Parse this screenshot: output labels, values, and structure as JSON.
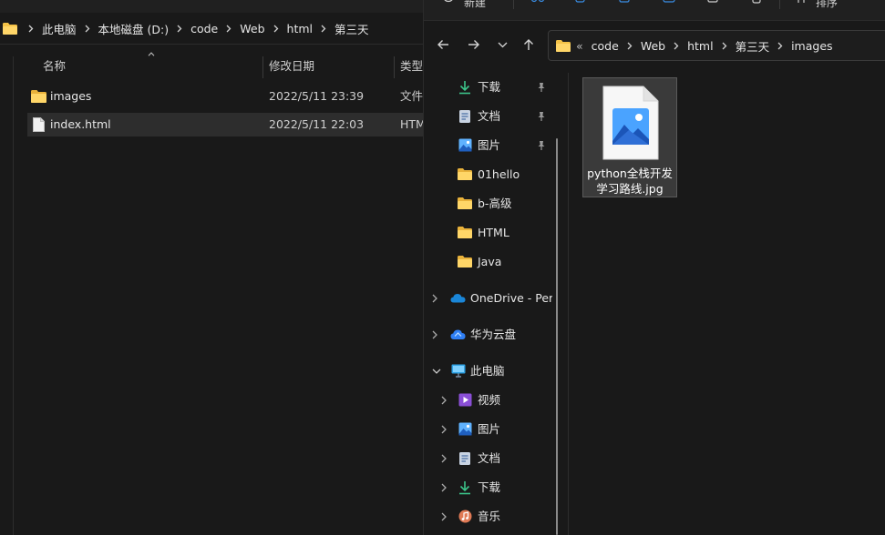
{
  "left_window": {
    "breadcrumb": [
      "此电脑",
      "本地磁盘 (D:)",
      "code",
      "Web",
      "html",
      "第三天"
    ],
    "columns": {
      "name": "名称",
      "modified": "修改日期",
      "type": "类型"
    },
    "files": [
      {
        "name": "images",
        "modified": "2022/5/11 23:39",
        "type": "文件",
        "icon": "folder-icon",
        "selected": false
      },
      {
        "name": "index.html",
        "modified": "2022/5/11 22:03",
        "type": "HTM",
        "icon": "file-icon",
        "selected": true
      }
    ]
  },
  "right_window": {
    "toolbar_partial": [
      "新建",
      "排序"
    ],
    "breadcrumb": [
      "code",
      "Web",
      "html",
      "第三天",
      "images"
    ],
    "breadcrumb_overflow": "«",
    "quick_access": [
      {
        "label": "下载",
        "icon": "download-icon",
        "pinned": true
      },
      {
        "label": "文档",
        "icon": "document-icon",
        "pinned": true
      },
      {
        "label": "图片",
        "icon": "pictures-icon",
        "pinned": true
      },
      {
        "label": "01hello",
        "icon": "folder-icon",
        "pinned": false
      },
      {
        "label": "b-高级",
        "icon": "folder-icon",
        "pinned": false
      },
      {
        "label": "HTML",
        "icon": "folder-icon",
        "pinned": false
      },
      {
        "label": "Java",
        "icon": "folder-icon",
        "pinned": false
      }
    ],
    "cloud": [
      {
        "label": "OneDrive - Pers",
        "icon": "onedrive-icon"
      },
      {
        "label": "华为云盘",
        "icon": "huawei-cloud-icon"
      }
    ],
    "this_pc": {
      "label": "此电脑",
      "children": [
        {
          "label": "视频",
          "icon": "videos-icon"
        },
        {
          "label": "图片",
          "icon": "pictures-icon"
        },
        {
          "label": "文档",
          "icon": "document-icon"
        },
        {
          "label": "下载",
          "icon": "download-icon"
        },
        {
          "label": "音乐",
          "icon": "music-icon"
        }
      ]
    },
    "file": {
      "name_line1": "python全栈开发",
      "name_line2": "学习路线.jpg",
      "icon": "image-file-icon"
    }
  },
  "colors": {
    "background": "#191919",
    "selection": "#2d2d2d",
    "folder": "#f4c247",
    "accent_blue": "#3a8ee6",
    "download_green": "#3cc48a"
  }
}
